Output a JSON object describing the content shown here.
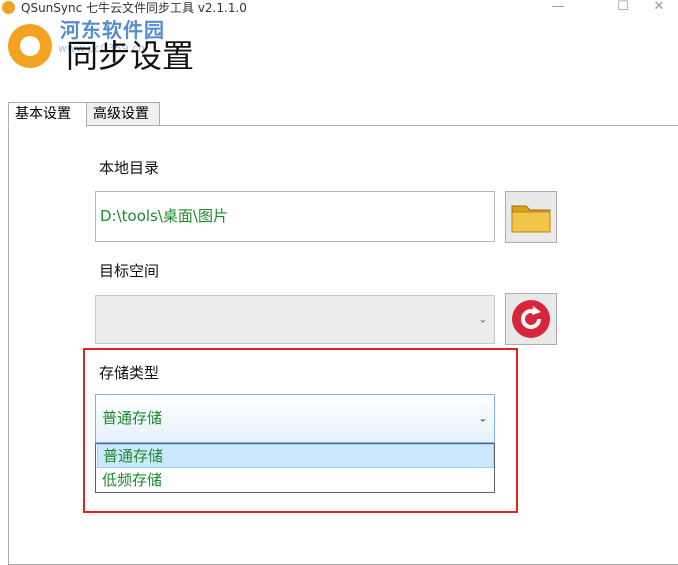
{
  "window": {
    "title": "QSunSync 七牛云文件同步工具 v2.1.1.0",
    "controls": {
      "minimize": "—",
      "maximize": "☐",
      "close": "✕"
    }
  },
  "watermark": {
    "text": "河东软件园",
    "url": "www.pc0359.cn"
  },
  "header": {
    "title": "同步设置"
  },
  "tabs": [
    {
      "label": "基本设置",
      "active": true
    },
    {
      "label": "高级设置",
      "active": false
    }
  ],
  "local_dir": {
    "label": "本地目录",
    "value": "D:\\tools\\桌面\\图片",
    "browse_icon": "folder-icon"
  },
  "target_space": {
    "label": "目标空间",
    "value": "",
    "refresh_icon": "refresh-icon"
  },
  "storage_type": {
    "label": "存储类型",
    "selected": "普通存储",
    "options": [
      "普通存储",
      "低频存储"
    ]
  },
  "colors": {
    "value_text": "#1e8a2d",
    "highlight": "#e32222",
    "selected_option_bg": "#cce8ff",
    "logo": "#f4a223"
  }
}
